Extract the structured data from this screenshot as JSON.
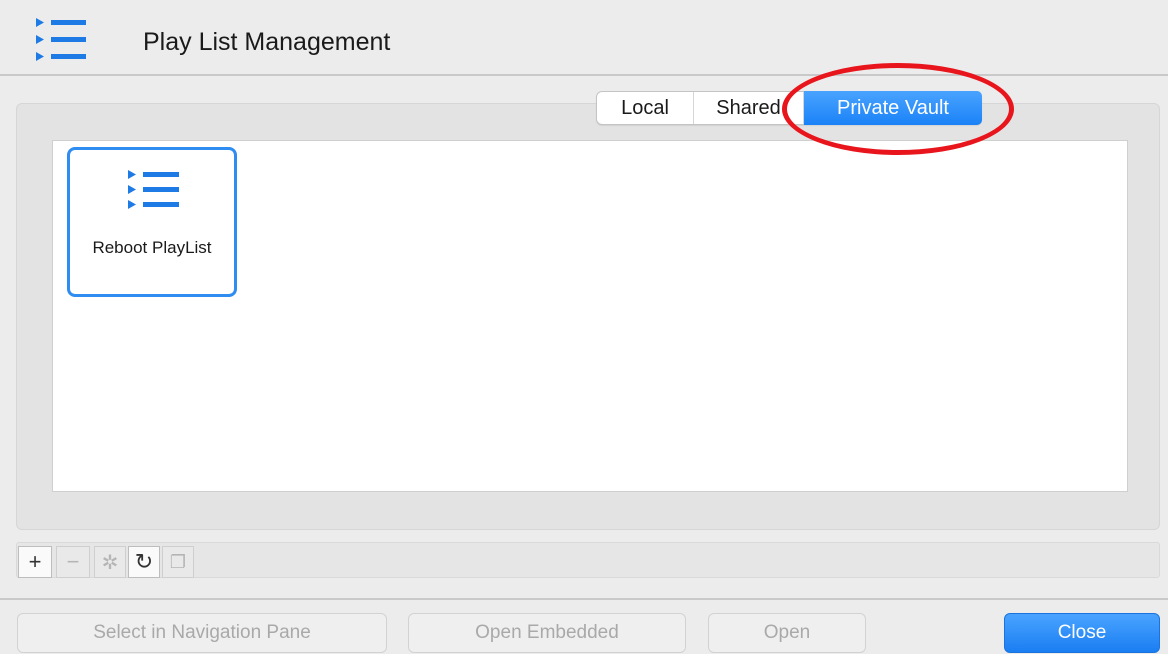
{
  "window": {
    "title": "Play List Management",
    "icon": "playlist-icon"
  },
  "tabs": [
    {
      "label": "Local",
      "selected": false
    },
    {
      "label": "Shared",
      "selected": false
    },
    {
      "label": "Private Vault",
      "selected": true
    }
  ],
  "items": [
    {
      "label": "Reboot PlayList",
      "icon": "playlist-icon",
      "selected": true
    }
  ],
  "toolbar": {
    "add": {
      "glyph": "+",
      "icon": "plus-icon",
      "enabled": true
    },
    "remove": {
      "glyph": "−",
      "icon": "minus-icon",
      "enabled": false
    },
    "settings": {
      "glyph": "✲",
      "icon": "gear-icon",
      "enabled": false
    },
    "refresh": {
      "glyph": "↻",
      "icon": "refresh-icon",
      "enabled": true
    },
    "copy": {
      "glyph": "❐",
      "icon": "copy-icon",
      "enabled": false
    }
  },
  "buttons": {
    "select_nav": "Select in Navigation Pane",
    "open_embedded": "Open Embedded",
    "open": "Open",
    "close": "Close"
  },
  "colors": {
    "accent": "#1a82f7",
    "annotation": "#e8161c",
    "icon_blue": "#1e7be6"
  }
}
